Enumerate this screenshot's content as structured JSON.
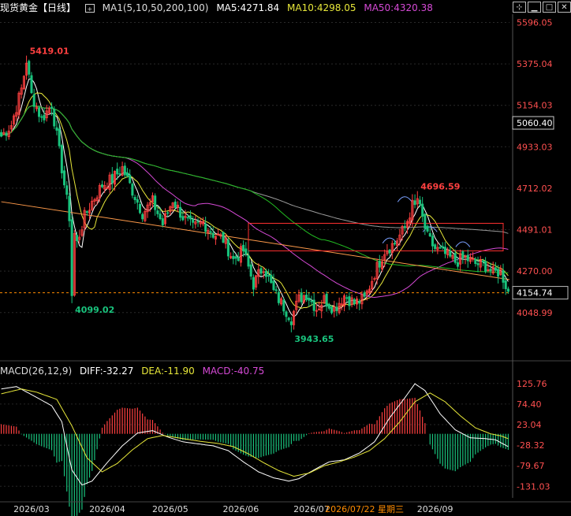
{
  "header": {
    "title": "现货黄金【日线】",
    "ma_name": "MA1(5,10,50,200,100)",
    "ma5": "MA5:4271.84",
    "ma10": "MA10:4298.05",
    "ma50": "MA50:4320.38",
    "plus_icon": "plus-icon",
    "tool_icons": [
      "crosshair-icon",
      "minimize-icon",
      "maximize-icon",
      "close-icon"
    ]
  },
  "macd_header": {
    "name": "MACD(26,12,9)",
    "diff": "DIFF:-32.27",
    "dea": "DEA:-11.90",
    "macd": "MACD:-40.75"
  },
  "colors": {
    "up": "#ff4040",
    "down": "#19c37d",
    "ma5": "#ffffff",
    "ma10": "#e8e83a",
    "ma50": "#d64ad6",
    "ma200": "#9a9a9a",
    "ma100": "#22bb22",
    "trendline": "#ff9a4a",
    "box": "#ff3030",
    "macd_pos": "#ff4040",
    "macd_neg": "#19c37d",
    "price_hl": "#ff8c00"
  },
  "chart_data": {
    "type": "candlestick",
    "price_axis": {
      "ticks": [
        "5596.05",
        "5375.04",
        "5154.03",
        "4933.03",
        "4712.02",
        "4491.01",
        "4270.00",
        "4048.99"
      ],
      "tick_values": [
        5596.05,
        5375.04,
        5154.03,
        4933.03,
        4712.02,
        4491.01,
        4270.0,
        4048.99
      ],
      "ylim": [
        3880,
        5640
      ]
    },
    "x_axis": {
      "labels": [
        "2026/03",
        "2026/04",
        "2026/05",
        "2026/06",
        "2026/07",
        "2026/07/22 星期三",
        "2026/09"
      ],
      "label_bars": [
        12,
        42,
        67,
        95,
        123,
        144,
        172
      ],
      "n_bars": 202
    },
    "labels": {
      "cursor_price": "5060.40",
      "cursor_price_value": 5060.4,
      "last_price": "4154.74",
      "last_price_value": 4154.74
    },
    "annotations": [
      {
        "text": "5419.01",
        "bar": 10,
        "value": 5419.01,
        "color": "up"
      },
      {
        "text": "4099.02",
        "bar": 28,
        "value": 4099.02,
        "color": "down"
      },
      {
        "text": "3943.65",
        "bar": 115,
        "value": 3943.65,
        "color": "down"
      },
      {
        "text": "4696.59",
        "bar": 165,
        "value": 4696.59,
        "color": "up"
      }
    ],
    "anchors": [
      [
        0,
        4990
      ],
      [
        4,
        5050
      ],
      [
        8,
        5240
      ],
      [
        10,
        5390
      ],
      [
        12,
        5210
      ],
      [
        16,
        5080
      ],
      [
        20,
        5160
      ],
      [
        24,
        4820
      ],
      [
        27,
        4560
      ],
      [
        30,
        4420
      ],
      [
        33,
        4560
      ],
      [
        36,
        4640
      ],
      [
        40,
        4730
      ],
      [
        44,
        4760
      ],
      [
        48,
        4820
      ],
      [
        52,
        4700
      ],
      [
        56,
        4580
      ],
      [
        60,
        4640
      ],
      [
        64,
        4520
      ],
      [
        68,
        4650
      ],
      [
        72,
        4560
      ],
      [
        76,
        4500
      ],
      [
        80,
        4530
      ],
      [
        84,
        4470
      ],
      [
        88,
        4440
      ],
      [
        92,
        4330
      ],
      [
        96,
        4380
      ],
      [
        100,
        4200
      ],
      [
        104,
        4300
      ],
      [
        108,
        4160
      ],
      [
        112,
        4080
      ],
      [
        115,
        4020
      ],
      [
        118,
        4120
      ],
      [
        121,
        4150
      ],
      [
        125,
        4070
      ],
      [
        128,
        4120
      ],
      [
        132,
        4070
      ],
      [
        136,
        4140
      ],
      [
        140,
        4100
      ],
      [
        144,
        4120
      ],
      [
        148,
        4260
      ],
      [
        152,
        4380
      ],
      [
        156,
        4420
      ],
      [
        160,
        4500
      ],
      [
        163,
        4620
      ],
      [
        166,
        4600
      ],
      [
        169,
        4450
      ],
      [
        172,
        4390
      ],
      [
        176,
        4360
      ],
      [
        180,
        4320
      ],
      [
        184,
        4340
      ],
      [
        188,
        4310
      ],
      [
        192,
        4300
      ],
      [
        195,
        4260
      ],
      [
        198,
        4270
      ],
      [
        201,
        4160
      ]
    ],
    "macd_axis": {
      "ticks": [
        "125.76",
        "74.40",
        "23.04",
        "-28.32",
        "-79.67",
        "-131.03"
      ],
      "tick_values": [
        125.76,
        74.4,
        23.04,
        -28.32,
        -79.67,
        -131.03
      ],
      "ylim": [
        -160,
        143
      ]
    },
    "macd_diff_anchors": [
      [
        0,
        112
      ],
      [
        6,
        118
      ],
      [
        12,
        98
      ],
      [
        20,
        70
      ],
      [
        24,
        30
      ],
      [
        28,
        -90
      ],
      [
        32,
        -128
      ],
      [
        36,
        -118
      ],
      [
        42,
        -72
      ],
      [
        48,
        -30
      ],
      [
        54,
        2
      ],
      [
        60,
        8
      ],
      [
        66,
        -8
      ],
      [
        72,
        -20
      ],
      [
        78,
        -25
      ],
      [
        84,
        -30
      ],
      [
        90,
        -42
      ],
      [
        96,
        -70
      ],
      [
        102,
        -95
      ],
      [
        108,
        -110
      ],
      [
        114,
        -118
      ],
      [
        118,
        -112
      ],
      [
        124,
        -90
      ],
      [
        130,
        -70
      ],
      [
        136,
        -65
      ],
      [
        142,
        -48
      ],
      [
        148,
        -20
      ],
      [
        154,
        40
      ],
      [
        160,
        90
      ],
      [
        164,
        125
      ],
      [
        168,
        108
      ],
      [
        174,
        50
      ],
      [
        180,
        10
      ],
      [
        186,
        -10
      ],
      [
        192,
        -12
      ],
      [
        196,
        -15
      ],
      [
        201,
        -32
      ]
    ],
    "macd_dea_anchors": [
      [
        0,
        100
      ],
      [
        8,
        112
      ],
      [
        14,
        104
      ],
      [
        22,
        86
      ],
      [
        28,
        20
      ],
      [
        34,
        -60
      ],
      [
        40,
        -95
      ],
      [
        46,
        -74
      ],
      [
        52,
        -40
      ],
      [
        58,
        -12
      ],
      [
        64,
        -4
      ],
      [
        70,
        -10
      ],
      [
        78,
        -18
      ],
      [
        86,
        -24
      ],
      [
        92,
        -32
      ],
      [
        98,
        -50
      ],
      [
        104,
        -72
      ],
      [
        110,
        -92
      ],
      [
        116,
        -106
      ],
      [
        122,
        -98
      ],
      [
        128,
        -80
      ],
      [
        134,
        -70
      ],
      [
        140,
        -58
      ],
      [
        146,
        -42
      ],
      [
        152,
        -12
      ],
      [
        158,
        30
      ],
      [
        164,
        80
      ],
      [
        170,
        102
      ],
      [
        176,
        80
      ],
      [
        182,
        45
      ],
      [
        188,
        15
      ],
      [
        194,
        0
      ],
      [
        198,
        -5
      ],
      [
        201,
        -12
      ]
    ]
  }
}
